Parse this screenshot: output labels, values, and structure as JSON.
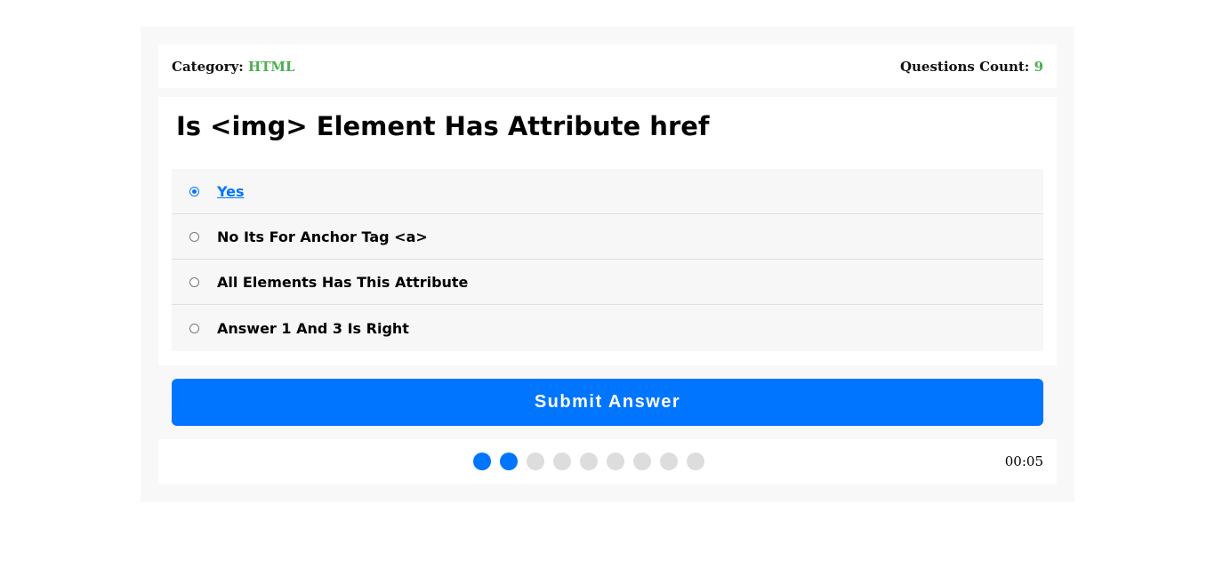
{
  "info": {
    "category_label": "Category:",
    "category_value": "HTML",
    "count_label": "Questions Count:",
    "count_value": "9"
  },
  "question": {
    "title": "Is <img> Element Has Attribute href",
    "answers": [
      {
        "label": "Yes",
        "selected": true
      },
      {
        "label": "No Its For Anchor Tag <a>",
        "selected": false
      },
      {
        "label": "All Elements Has This Attribute",
        "selected": false
      },
      {
        "label": "Answer 1 And 3 Is Right",
        "selected": false
      }
    ]
  },
  "submit_label": "Submit Answer",
  "progress": {
    "total": 9,
    "completed": 2
  },
  "countdown": "00:05",
  "colors": {
    "accent_blue": "#0075ff",
    "accent_green": "#4caf50",
    "bullet_off": "#dddddd"
  }
}
